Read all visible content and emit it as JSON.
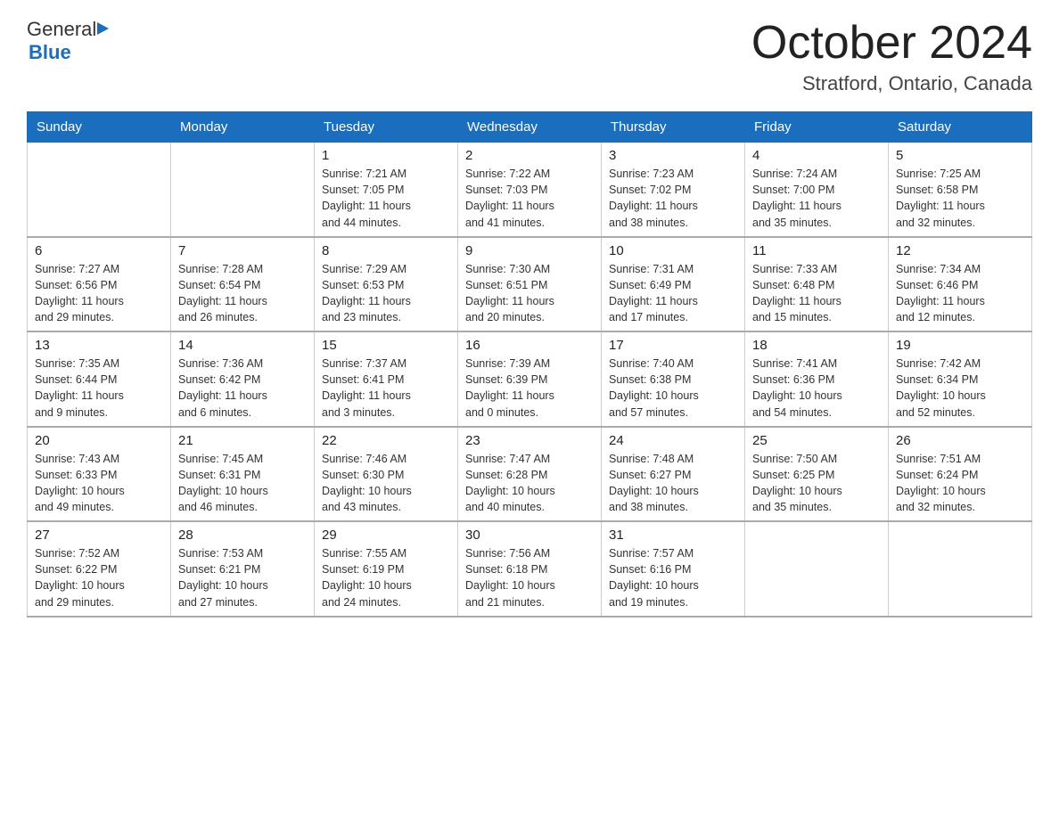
{
  "header": {
    "logo_general": "General",
    "logo_blue": "Blue",
    "title": "October 2024",
    "subtitle": "Stratford, Ontario, Canada"
  },
  "days_of_week": [
    "Sunday",
    "Monday",
    "Tuesday",
    "Wednesday",
    "Thursday",
    "Friday",
    "Saturday"
  ],
  "weeks": [
    {
      "days": [
        {
          "number": "",
          "info": ""
        },
        {
          "number": "",
          "info": ""
        },
        {
          "number": "1",
          "info": "Sunrise: 7:21 AM\nSunset: 7:05 PM\nDaylight: 11 hours\nand 44 minutes."
        },
        {
          "number": "2",
          "info": "Sunrise: 7:22 AM\nSunset: 7:03 PM\nDaylight: 11 hours\nand 41 minutes."
        },
        {
          "number": "3",
          "info": "Sunrise: 7:23 AM\nSunset: 7:02 PM\nDaylight: 11 hours\nand 38 minutes."
        },
        {
          "number": "4",
          "info": "Sunrise: 7:24 AM\nSunset: 7:00 PM\nDaylight: 11 hours\nand 35 minutes."
        },
        {
          "number": "5",
          "info": "Sunrise: 7:25 AM\nSunset: 6:58 PM\nDaylight: 11 hours\nand 32 minutes."
        }
      ]
    },
    {
      "days": [
        {
          "number": "6",
          "info": "Sunrise: 7:27 AM\nSunset: 6:56 PM\nDaylight: 11 hours\nand 29 minutes."
        },
        {
          "number": "7",
          "info": "Sunrise: 7:28 AM\nSunset: 6:54 PM\nDaylight: 11 hours\nand 26 minutes."
        },
        {
          "number": "8",
          "info": "Sunrise: 7:29 AM\nSunset: 6:53 PM\nDaylight: 11 hours\nand 23 minutes."
        },
        {
          "number": "9",
          "info": "Sunrise: 7:30 AM\nSunset: 6:51 PM\nDaylight: 11 hours\nand 20 minutes."
        },
        {
          "number": "10",
          "info": "Sunrise: 7:31 AM\nSunset: 6:49 PM\nDaylight: 11 hours\nand 17 minutes."
        },
        {
          "number": "11",
          "info": "Sunrise: 7:33 AM\nSunset: 6:48 PM\nDaylight: 11 hours\nand 15 minutes."
        },
        {
          "number": "12",
          "info": "Sunrise: 7:34 AM\nSunset: 6:46 PM\nDaylight: 11 hours\nand 12 minutes."
        }
      ]
    },
    {
      "days": [
        {
          "number": "13",
          "info": "Sunrise: 7:35 AM\nSunset: 6:44 PM\nDaylight: 11 hours\nand 9 minutes."
        },
        {
          "number": "14",
          "info": "Sunrise: 7:36 AM\nSunset: 6:42 PM\nDaylight: 11 hours\nand 6 minutes."
        },
        {
          "number": "15",
          "info": "Sunrise: 7:37 AM\nSunset: 6:41 PM\nDaylight: 11 hours\nand 3 minutes."
        },
        {
          "number": "16",
          "info": "Sunrise: 7:39 AM\nSunset: 6:39 PM\nDaylight: 11 hours\nand 0 minutes."
        },
        {
          "number": "17",
          "info": "Sunrise: 7:40 AM\nSunset: 6:38 PM\nDaylight: 10 hours\nand 57 minutes."
        },
        {
          "number": "18",
          "info": "Sunrise: 7:41 AM\nSunset: 6:36 PM\nDaylight: 10 hours\nand 54 minutes."
        },
        {
          "number": "19",
          "info": "Sunrise: 7:42 AM\nSunset: 6:34 PM\nDaylight: 10 hours\nand 52 minutes."
        }
      ]
    },
    {
      "days": [
        {
          "number": "20",
          "info": "Sunrise: 7:43 AM\nSunset: 6:33 PM\nDaylight: 10 hours\nand 49 minutes."
        },
        {
          "number": "21",
          "info": "Sunrise: 7:45 AM\nSunset: 6:31 PM\nDaylight: 10 hours\nand 46 minutes."
        },
        {
          "number": "22",
          "info": "Sunrise: 7:46 AM\nSunset: 6:30 PM\nDaylight: 10 hours\nand 43 minutes."
        },
        {
          "number": "23",
          "info": "Sunrise: 7:47 AM\nSunset: 6:28 PM\nDaylight: 10 hours\nand 40 minutes."
        },
        {
          "number": "24",
          "info": "Sunrise: 7:48 AM\nSunset: 6:27 PM\nDaylight: 10 hours\nand 38 minutes."
        },
        {
          "number": "25",
          "info": "Sunrise: 7:50 AM\nSunset: 6:25 PM\nDaylight: 10 hours\nand 35 minutes."
        },
        {
          "number": "26",
          "info": "Sunrise: 7:51 AM\nSunset: 6:24 PM\nDaylight: 10 hours\nand 32 minutes."
        }
      ]
    },
    {
      "days": [
        {
          "number": "27",
          "info": "Sunrise: 7:52 AM\nSunset: 6:22 PM\nDaylight: 10 hours\nand 29 minutes."
        },
        {
          "number": "28",
          "info": "Sunrise: 7:53 AM\nSunset: 6:21 PM\nDaylight: 10 hours\nand 27 minutes."
        },
        {
          "number": "29",
          "info": "Sunrise: 7:55 AM\nSunset: 6:19 PM\nDaylight: 10 hours\nand 24 minutes."
        },
        {
          "number": "30",
          "info": "Sunrise: 7:56 AM\nSunset: 6:18 PM\nDaylight: 10 hours\nand 21 minutes."
        },
        {
          "number": "31",
          "info": "Sunrise: 7:57 AM\nSunset: 6:16 PM\nDaylight: 10 hours\nand 19 minutes."
        },
        {
          "number": "",
          "info": ""
        },
        {
          "number": "",
          "info": ""
        }
      ]
    }
  ],
  "accent_color": "#1a6ebd"
}
